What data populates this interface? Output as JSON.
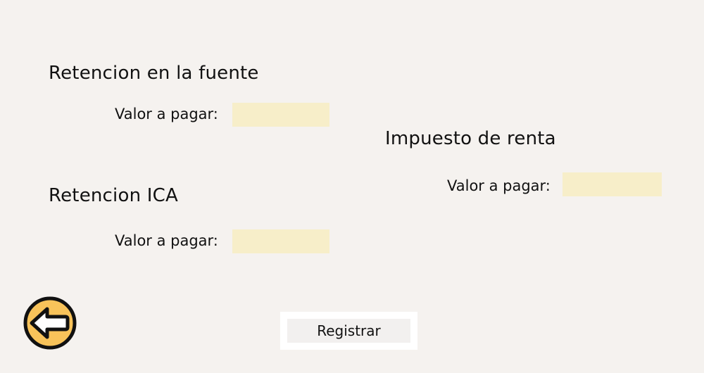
{
  "sections": {
    "retencion_fuente": {
      "title": "Retencion en la fuente",
      "field_label": "Valor a pagar:",
      "field_value": ""
    },
    "retencion_ica": {
      "title": "Retencion ICA",
      "field_label": "Valor a pagar:",
      "field_value": ""
    },
    "impuesto_renta": {
      "title": "Impuesto de renta",
      "field_label": "Valor a pagar:",
      "field_value": ""
    }
  },
  "actions": {
    "register_label": "Registrar",
    "back_icon": "arrow-left-icon"
  },
  "colors": {
    "background": "#f5f2ef",
    "input_fill": "#f7eec9",
    "back_button_fill": "#f8c35a",
    "back_button_stroke": "#111111"
  }
}
